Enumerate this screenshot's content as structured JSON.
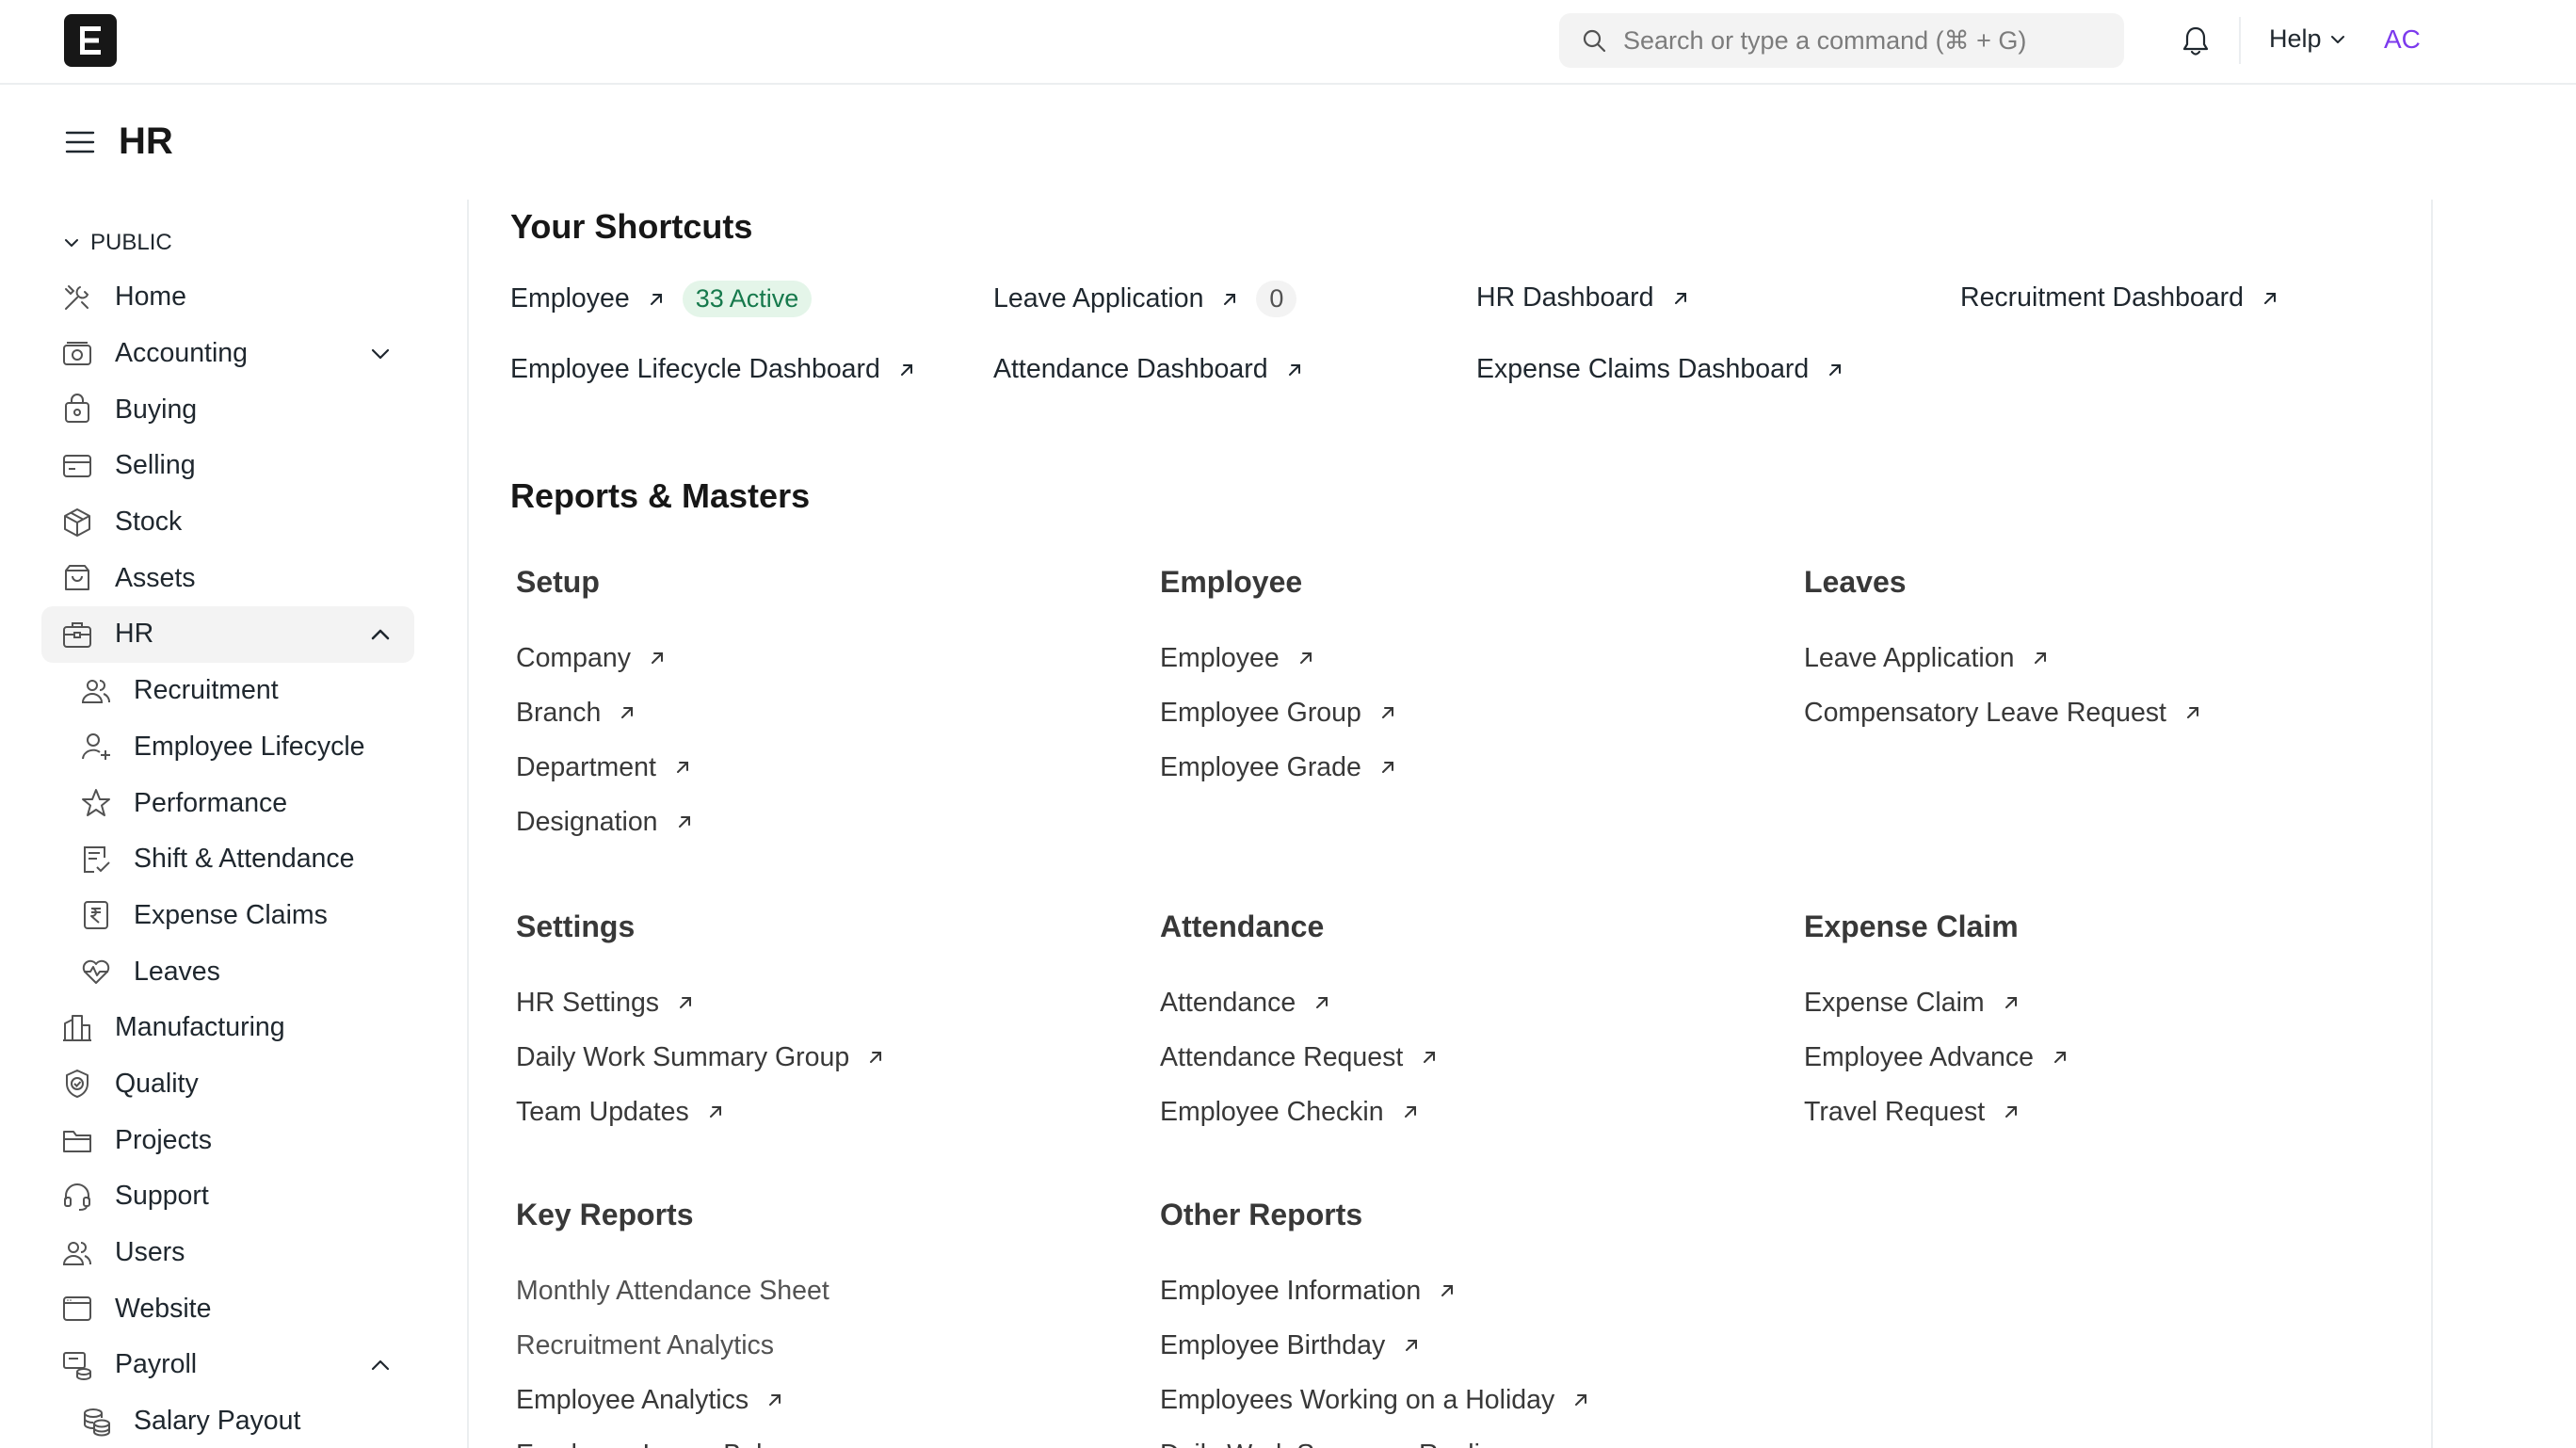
{
  "navbar": {
    "logo_letter": "E",
    "search_placeholder": "Search or type a command (⌘ + G)",
    "help_label": "Help",
    "avatar_initials": "AC"
  },
  "page": {
    "title": "HR"
  },
  "sidebar": {
    "section_label": "PUBLIC",
    "items": [
      {
        "label": "Home",
        "icon": "tools-icon"
      },
      {
        "label": "Accounting",
        "icon": "accounting-icon"
      },
      {
        "label": "Buying",
        "icon": "buying-icon"
      },
      {
        "label": "Selling",
        "icon": "selling-icon"
      },
      {
        "label": "Stock",
        "icon": "stock-icon"
      },
      {
        "label": "Assets",
        "icon": "assets-icon"
      },
      {
        "label": "HR",
        "icon": "hr-icon"
      },
      {
        "label": "Recruitment",
        "icon": "users-icon"
      },
      {
        "label": "Employee Lifecycle",
        "icon": "user-plus-icon"
      },
      {
        "label": "Performance",
        "icon": "star-icon"
      },
      {
        "label": "Shift & Attendance",
        "icon": "attendance-icon"
      },
      {
        "label": "Expense Claims",
        "icon": "rupee-icon"
      },
      {
        "label": "Leaves",
        "icon": "heartbeat-icon"
      },
      {
        "label": "Manufacturing",
        "icon": "factory-icon"
      },
      {
        "label": "Quality",
        "icon": "quality-icon"
      },
      {
        "label": "Projects",
        "icon": "folder-icon"
      },
      {
        "label": "Support",
        "icon": "headset-icon"
      },
      {
        "label": "Users",
        "icon": "users-icon"
      },
      {
        "label": "Website",
        "icon": "website-icon"
      },
      {
        "label": "Payroll",
        "icon": "payroll-icon"
      },
      {
        "label": "Salary Payout",
        "icon": "coins-icon"
      }
    ]
  },
  "shortcuts": {
    "heading": "Your Shortcuts",
    "items": [
      {
        "label": "Employee",
        "badge": "33 Active"
      },
      {
        "label": "Leave Application",
        "badge": "0"
      },
      {
        "label": "HR Dashboard"
      },
      {
        "label": "Recruitment Dashboard"
      },
      {
        "label": "Employee Lifecycle Dashboard"
      },
      {
        "label": "Attendance Dashboard"
      },
      {
        "label": "Expense Claims Dashboard"
      }
    ]
  },
  "reports": {
    "heading": "Reports & Masters",
    "cards": [
      {
        "title": "Setup",
        "links": [
          "Company",
          "Branch",
          "Department",
          "Designation"
        ]
      },
      {
        "title": "Employee",
        "links": [
          "Employee",
          "Employee Group",
          "Employee Grade"
        ]
      },
      {
        "title": "Leaves",
        "links": [
          "Leave Application",
          "Compensatory Leave Request"
        ]
      },
      {
        "title": "Settings",
        "links": [
          "HR Settings",
          "Daily Work Summary Group",
          "Team Updates"
        ]
      },
      {
        "title": "Attendance",
        "links": [
          "Attendance",
          "Attendance Request",
          "Employee Checkin"
        ]
      },
      {
        "title": "Expense Claim",
        "links": [
          "Expense Claim",
          "Employee Advance",
          "Travel Request"
        ]
      },
      {
        "title": "Key Reports",
        "links": [
          "Monthly Attendance Sheet",
          "Recruitment Analytics",
          "Employee Analytics",
          "Employee Leave Balance"
        ]
      },
      {
        "title": "Other Reports",
        "links": [
          "Employee Information",
          "Employee Birthday",
          "Employees Working on a Holiday",
          "Daily Work Summary Replies"
        ]
      }
    ]
  }
}
